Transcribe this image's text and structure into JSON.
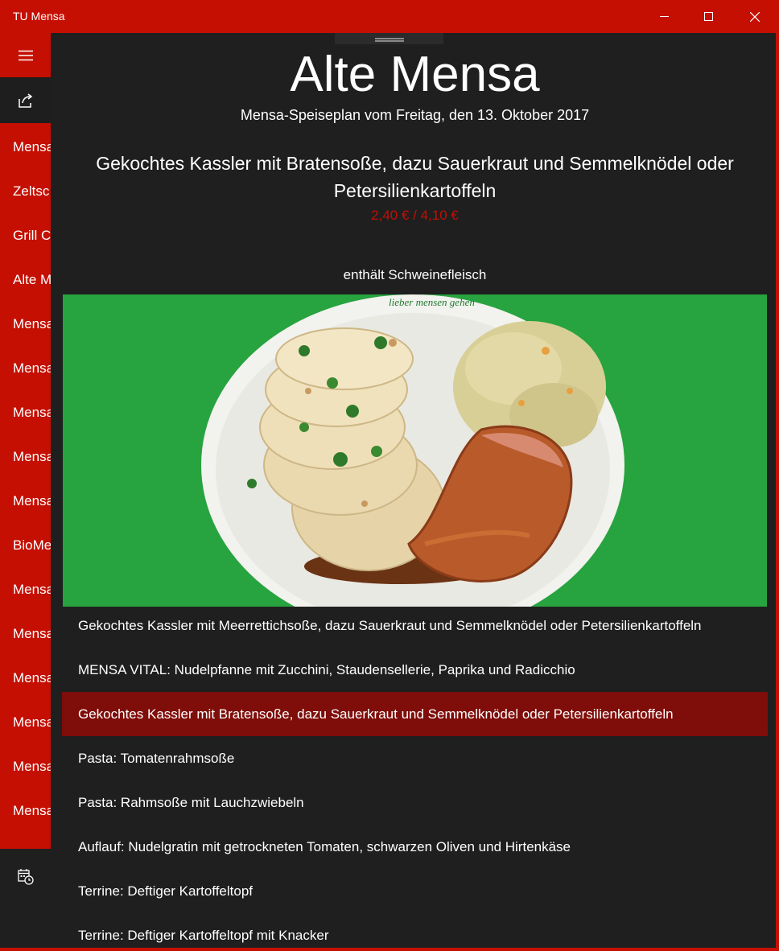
{
  "window": {
    "title": "TU Mensa",
    "minimize_icon": "minimize-icon",
    "maximize_icon": "maximize-icon",
    "close_icon": "close-icon"
  },
  "sidebar": {
    "menu_icon": "hamburger-icon",
    "share_icon": "share-icon",
    "calendar_icon": "calendar-clock-icon",
    "items": [
      {
        "label": "Mensa"
      },
      {
        "label": "Zeltsc"
      },
      {
        "label": "Grill C"
      },
      {
        "label": "Alte M"
      },
      {
        "label": "Mensa"
      },
      {
        "label": "Mensa"
      },
      {
        "label": "Mensa"
      },
      {
        "label": "Mensa"
      },
      {
        "label": "Mensa"
      },
      {
        "label": "BioMe"
      },
      {
        "label": "Mensa"
      },
      {
        "label": "Mensa"
      },
      {
        "label": "Mensa"
      },
      {
        "label": "Mensa"
      },
      {
        "label": "Mensa"
      },
      {
        "label": "Mensa"
      }
    ]
  },
  "detail": {
    "mensa_name": "Alte Mensa",
    "plan_date": "Mensa-Speiseplan vom Freitag, den 13. Oktober 2017",
    "dish_title": "Gekochtes Kassler mit Bratensoße, dazu Sauerkraut und Semmelknödel oder Petersilienkartoffeln",
    "price": "2,40 € / 4,10 €",
    "allergen": "enthält Schweinefleisch",
    "photo_caption": "lieber mensen gehen"
  },
  "menu": {
    "selected_index": 2,
    "items": [
      {
        "label": "Gekochtes Kassler mit Meerrettichsoße, dazu Sauerkraut und Semmelknödel oder Petersilienkartoffeln"
      },
      {
        "label": "MENSA VITAL: Nudelpfanne mit Zucchini, Staudensellerie, Paprika und Radicchio"
      },
      {
        "label": "Gekochtes Kassler mit Bratensoße, dazu Sauerkraut und Semmelknödel oder Petersilienkartoffeln"
      },
      {
        "label": "Pasta: Tomatenrahmsoße"
      },
      {
        "label": "Pasta: Rahmsoße mit Lauchzwiebeln"
      },
      {
        "label": "Auflauf: Nudelgratin mit getrockneten Tomaten, schwarzen Oliven und Hirtenkäse"
      },
      {
        "label": "Terrine: Deftiger Kartoffeltopf"
      },
      {
        "label": "Terrine: Deftiger Kartoffeltopf mit Knacker"
      }
    ]
  },
  "colors": {
    "accent": "#c50f02",
    "selected_row": "#7f0d09",
    "background": "#1f1f1f",
    "photo_background": "#27a33f"
  }
}
